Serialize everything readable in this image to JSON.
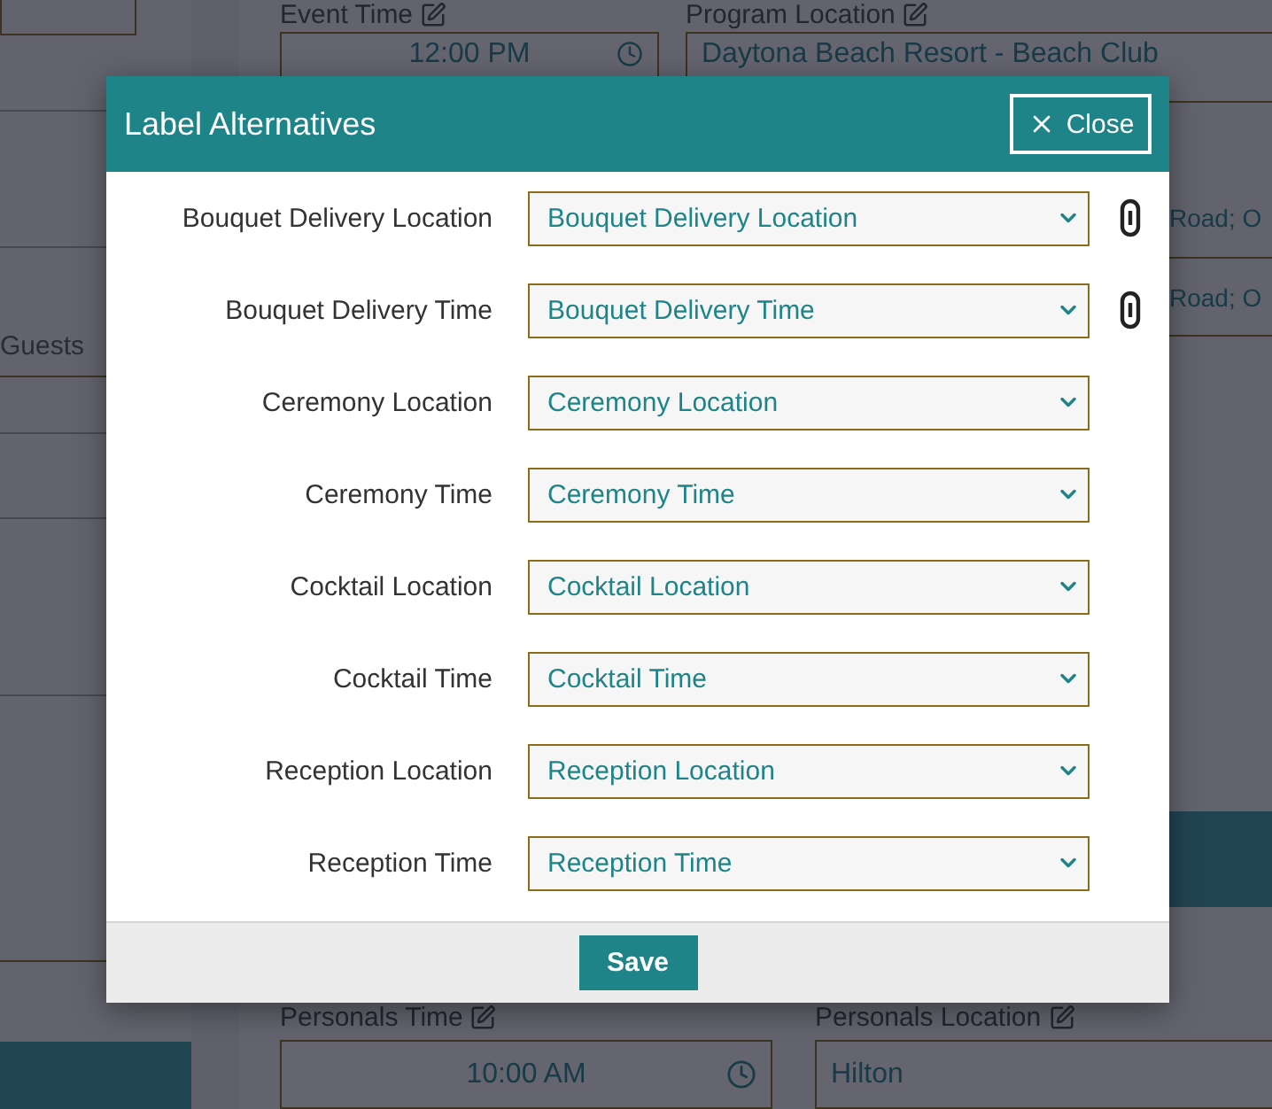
{
  "background": {
    "left_label": "Guests",
    "event_time": {
      "label": "Event Time",
      "value": "12:00 PM"
    },
    "program_location": {
      "label": "Program Location",
      "value": "Daytona Beach Resort - Beach Club"
    },
    "address_fragments": [
      "Road; O",
      "Road; O"
    ],
    "personals_time": {
      "label": "Personals Time",
      "value": "10:00 AM"
    },
    "personals_location": {
      "label": "Personals Location",
      "value": "Hilton"
    }
  },
  "modal": {
    "title": "Label Alternatives",
    "close_label": "Close",
    "rows": [
      {
        "label": "Bouquet Delivery Location",
        "value": "Bouquet Delivery Location",
        "linked": true
      },
      {
        "label": "Bouquet Delivery Time",
        "value": "Bouquet Delivery Time",
        "linked": true
      },
      {
        "label": "Ceremony Location",
        "value": "Ceremony Location",
        "linked": false
      },
      {
        "label": "Ceremony Time",
        "value": "Ceremony Time",
        "linked": false
      },
      {
        "label": "Cocktail Location",
        "value": "Cocktail Location",
        "linked": false
      },
      {
        "label": "Cocktail Time",
        "value": "Cocktail Time",
        "linked": false
      },
      {
        "label": "Reception Location",
        "value": "Reception Location",
        "linked": false
      },
      {
        "label": "Reception Time",
        "value": "Reception Time",
        "linked": false
      }
    ],
    "save_label": "Save"
  }
}
